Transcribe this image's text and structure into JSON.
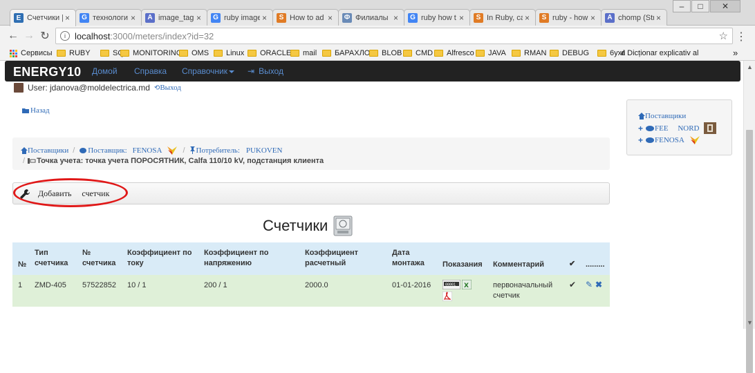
{
  "browser": {
    "tabs": [
      {
        "label": "Счетчики |",
        "fav_color": "#2f6fb3",
        "fav_glyph": "E",
        "active": true
      },
      {
        "label": "технологи",
        "fav_color": "#4285f4",
        "fav_glyph": "G"
      },
      {
        "label": "image_tag",
        "fav_color": "#5b6fc9",
        "fav_glyph": "A"
      },
      {
        "label": "ruby image",
        "fav_color": "#4285f4",
        "fav_glyph": "G"
      },
      {
        "label": "How to ad",
        "fav_color": "#e07b25",
        "fav_glyph": "S"
      },
      {
        "label": "Филиалы",
        "fav_color": "#6a8bb7",
        "fav_glyph": "Ф"
      },
      {
        "label": "ruby how t",
        "fav_color": "#4285f4",
        "fav_glyph": "G"
      },
      {
        "label": "In Ruby, ca",
        "fav_color": "#e07b25",
        "fav_glyph": "S"
      },
      {
        "label": "ruby - how",
        "fav_color": "#e07b25",
        "fav_glyph": "S"
      },
      {
        "label": "chomp (Str",
        "fav_color": "#5b6fc9",
        "fav_glyph": "A"
      }
    ],
    "url_host": "localhost",
    "url_rest": ":3000/meters/index?id=32",
    "bookmarks": [
      "Сервисы",
      "RUBY",
      "SQL",
      "MONITORING",
      "OMS",
      "Linux",
      "ORACLE",
      "mail",
      "БАРАХЛО",
      "BLOB",
      "CMD",
      "Alfresco",
      "JAVA",
      "RMAN",
      "DEBUG",
      "6ухг",
      "Dicționar explicativ al"
    ],
    "more": "»"
  },
  "navbar": {
    "brand": "ENERGY10",
    "links": [
      "Домой",
      "Справка",
      "Справочник",
      "Выход"
    ]
  },
  "user": {
    "label": "User: jdanova@moldelectrica.md",
    "logout": "Выход"
  },
  "back": "Назад",
  "sidepanel": {
    "title": "Поставщики",
    "items": [
      "FEE     NORD",
      "FENOSA"
    ]
  },
  "breadcrumb": {
    "suppliers": "Поставщики",
    "supplier_label": "Поставщик:",
    "supplier_name": "FENOSA",
    "consumer_label": "Потребитель:",
    "consumer_name": "PUKOVEN",
    "point": "Точка учета: точка учета ПОРОСЯТНИК, Calfa 110/10 kV, подстанция клиента"
  },
  "add_button": "Добавить     счетчик",
  "page_title": "Счетчики",
  "table": {
    "headers": [
      "№",
      "Тип счетчика",
      "№ счетчика",
      "Коэффициент по току",
      "Коэффициент по напряжению",
      "Коэффициент расчетный",
      "Дата монтажа",
      "Показания",
      "Комментарий",
      "✔",
      "........."
    ],
    "rows": [
      {
        "n": "1",
        "type": "ZMD-405",
        "serial": "57522852",
        "k_current": "10 / 1",
        "k_voltage": "200 / 1",
        "k_calc": "2000.0",
        "date": "01-01-2016",
        "comment": "первоначальный счетчик",
        "check": "✔"
      }
    ]
  },
  "colors": {
    "accent_link": "#2f6ab7",
    "navbar_bg": "#222222",
    "header_bg": "#d9ebf7",
    "row_bg": "#dff0d8",
    "highlight": "#e01818"
  }
}
